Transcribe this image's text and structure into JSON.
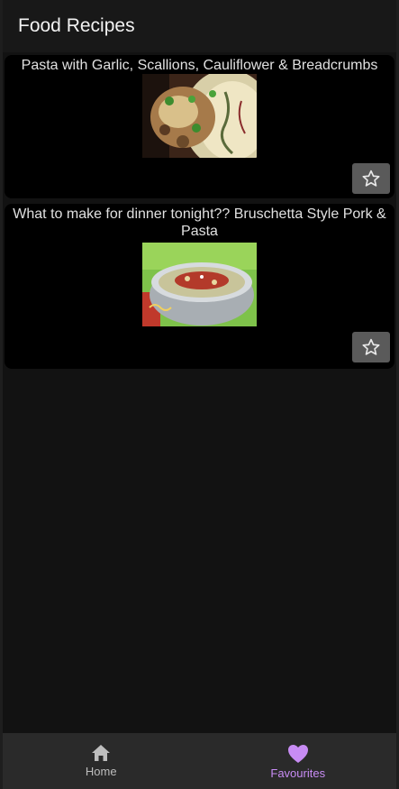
{
  "app": {
    "title": "Food Recipes"
  },
  "recipes": [
    {
      "title": "Pasta with Garlic, Scallions, Cauliflower & Breadcrumbs",
      "favourite_icon": "star-outline-icon"
    },
    {
      "title": "What to make for dinner tonight?? Bruschetta Style Pork & Pasta",
      "favourite_icon": "star-outline-icon"
    }
  ],
  "bottom_nav": {
    "items": [
      {
        "label": "Home",
        "icon": "home-icon",
        "active": false
      },
      {
        "label": "Favourites",
        "icon": "heart-icon",
        "active": true
      }
    ]
  },
  "colors": {
    "background": "#121212",
    "card": "#000000",
    "accent": "#c88cf4",
    "nav_bg": "#2a2a2a"
  }
}
